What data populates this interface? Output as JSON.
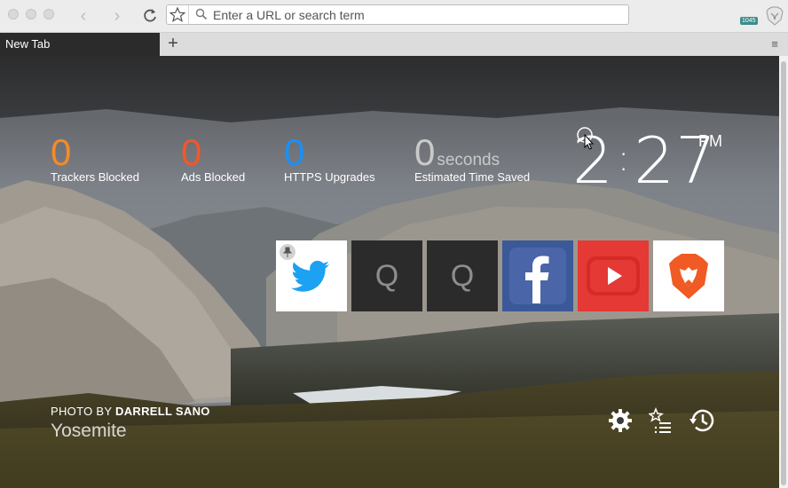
{
  "browser": {
    "url_placeholder": "Enter a URL or search term",
    "extension_badge": "1045",
    "tab_title": "New Tab",
    "new_tab_symbol": "+",
    "tab_menu_symbol": "≡",
    "back_symbol": "‹",
    "forward_symbol": "›"
  },
  "stats": [
    {
      "value": "0",
      "label": "Trackers Blocked",
      "color": "#f58a27"
    },
    {
      "value": "0",
      "label": "Ads Blocked",
      "color": "#f4562a"
    },
    {
      "value": "0",
      "label": "HTTPS Upgrades",
      "color": "#1b90f5"
    },
    {
      "value": "0",
      "unit": "seconds",
      "label": "Estimated Time Saved",
      "color": "#c9c9c9"
    }
  ],
  "clock": {
    "hours": "2",
    "minutes": "27",
    "ampm": "PM"
  },
  "top_sites": [
    {
      "name": "twitter",
      "pinned": true
    },
    {
      "name": "placeholder",
      "letter": "Q"
    },
    {
      "name": "placeholder",
      "letter": "Q"
    },
    {
      "name": "facebook"
    },
    {
      "name": "youtube"
    },
    {
      "name": "brave"
    }
  ],
  "photo": {
    "credit_prefix": "PHOTO BY",
    "photographer": "DARRELL SANO",
    "location": "Yosemite"
  },
  "icons": [
    "settings-icon",
    "bookmarks-icon",
    "history-icon"
  ]
}
